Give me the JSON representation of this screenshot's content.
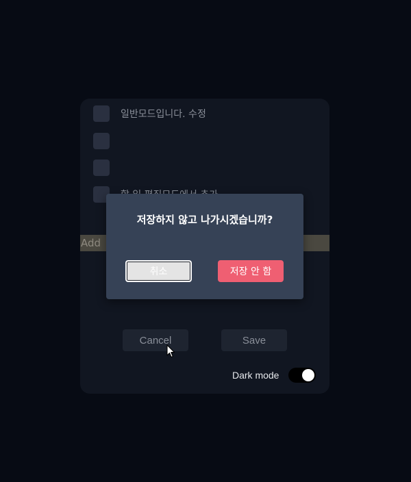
{
  "todos": [
    {
      "text": "일반모드입니다. 수정"
    },
    {
      "text": ""
    },
    {
      "text": ""
    },
    {
      "text": "할 일 편집모드에서 추가"
    }
  ],
  "add_input": {
    "placeholder": "Add",
    "value": ""
  },
  "footer": {
    "cancel_label": "Cancel",
    "save_label": "Save"
  },
  "dark_mode": {
    "label": "Dark mode",
    "enabled": true
  },
  "modal": {
    "title": "저장하지 않고 나가시겠습니까?",
    "cancel_label": "취소",
    "dont_save_label": "저장 안 함"
  },
  "colors": {
    "background": "#070b14",
    "card": "#111621",
    "modal": "#364256",
    "danger": "#ef5f72"
  }
}
